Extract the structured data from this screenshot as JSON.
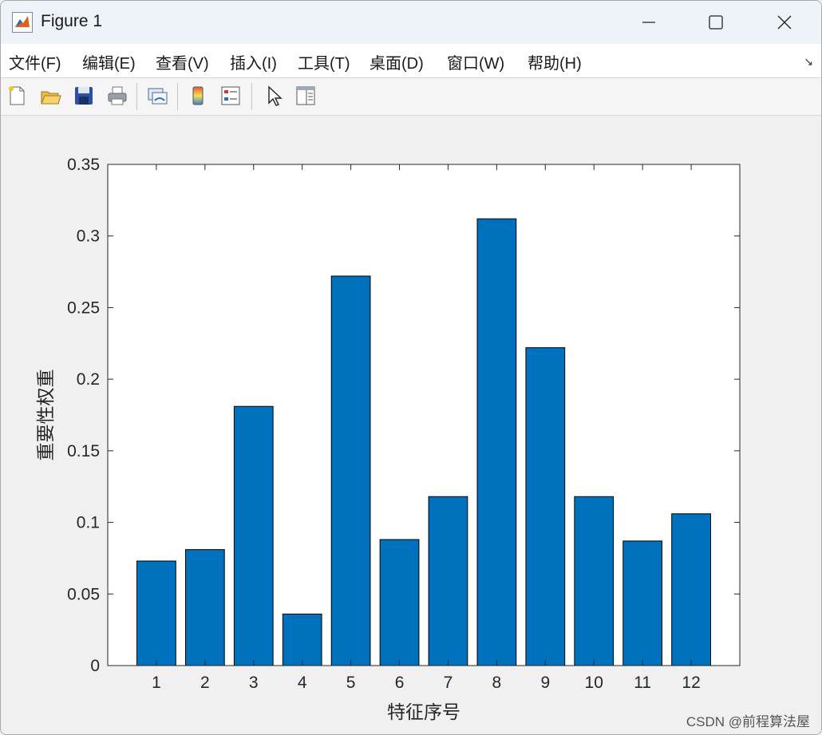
{
  "window": {
    "title": "Figure 1",
    "icon": "matlab-icon",
    "controls": [
      "minimize-icon",
      "maximize-icon",
      "close-icon"
    ]
  },
  "menubar": {
    "items": [
      {
        "label": "文件(F)"
      },
      {
        "label": "编辑(E)"
      },
      {
        "label": "查看(V)"
      },
      {
        "label": "插入(I)"
      },
      {
        "label": "工具(T)"
      },
      {
        "label": "桌面(D)"
      },
      {
        "label": "窗口(W)"
      },
      {
        "label": "帮助(H)"
      }
    ],
    "dock_arrow": "↘"
  },
  "toolbar": {
    "buttons": [
      "new-figure-icon",
      "open-file-icon",
      "save-icon",
      "print-icon",
      "link-plot-icon",
      "colorbar-icon",
      "legend-icon",
      "pointer-icon",
      "property-inspector-icon"
    ]
  },
  "footer": {
    "watermark": "CSDN @前程算法屋"
  },
  "chart_data": {
    "type": "bar",
    "categories": [
      "1",
      "2",
      "3",
      "4",
      "5",
      "6",
      "7",
      "8",
      "9",
      "10",
      "11",
      "12"
    ],
    "values": [
      0.073,
      0.081,
      0.181,
      0.036,
      0.272,
      0.088,
      0.118,
      0.312,
      0.222,
      0.118,
      0.087,
      0.106
    ],
    "xlabel": "特征序号",
    "ylabel": "重要性权重",
    "ylim": [
      0,
      0.35
    ],
    "yticks": [
      "0",
      "0.05",
      "0.1",
      "0.15",
      "0.2",
      "0.25",
      "0.3",
      "0.35"
    ],
    "bar_color": "#0072bd",
    "grid": false
  }
}
